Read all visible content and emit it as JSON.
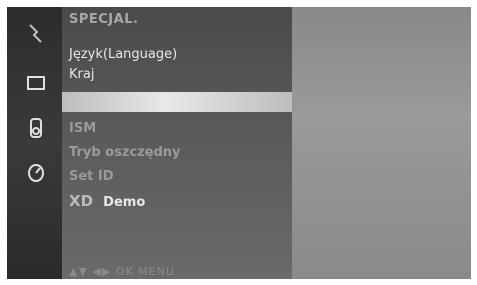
{
  "menu": {
    "title": "SPECJAL.",
    "items": [
      {
        "label": "Język(Language)"
      },
      {
        "label": "Kraj"
      },
      {
        "label": ""
      },
      {
        "label": "ISM"
      },
      {
        "label": "Tryb oszczędny"
      },
      {
        "label": "Set ID"
      },
      {
        "label": "Demo",
        "logo": "XD"
      }
    ],
    "footer": "▲▼ ◀▶ OK MENU"
  },
  "icons": [
    "input-icon",
    "screen-icon",
    "speaker-icon",
    "time-icon"
  ]
}
